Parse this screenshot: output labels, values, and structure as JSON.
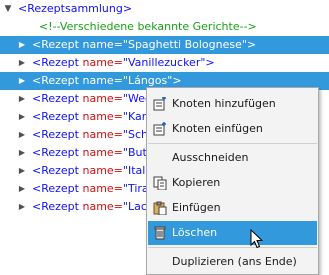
{
  "tree": {
    "root": "<Rezeptsammlung>",
    "comment": "<!--Verschiedene bekannte Gerichte-->",
    "rows": [
      {
        "open": "<Rezept",
        "attr": "name=",
        "value": "\"Spaghetti Bolognese\"",
        "close": ">",
        "selected": true
      },
      {
        "open": "<Rezept",
        "attr": "name=",
        "value": "\"Vanillezucker\"",
        "close": ">",
        "selected": false
      },
      {
        "open": "<Rezept",
        "attr": "name=",
        "value": "\"Lángos\"",
        "close": ">",
        "selected": true
      },
      {
        "open": "<Rezept",
        "attr": "name=",
        "value": "\"Wec",
        "close": "",
        "selected": false
      },
      {
        "open": "<Rezept",
        "attr": "name=",
        "value": "\"Kart",
        "close": "",
        "selected": false
      },
      {
        "open": "<Rezept",
        "attr": "name=",
        "value": "\"Scha",
        "close": "",
        "selected": false
      },
      {
        "open": "<Rezept",
        "attr": "name=",
        "value": "\"Butt",
        "close": "",
        "selected": false
      },
      {
        "open": "<Rezept",
        "attr": "name=",
        "value": "\"Itali",
        "close": "",
        "selected": false
      },
      {
        "open": "<Rezept",
        "attr": "name=",
        "value": "\"Tira",
        "close": "",
        "selected": false
      },
      {
        "open": "<Rezept",
        "attr": "name=",
        "value": "\"Lach",
        "close": "",
        "selected": false
      }
    ]
  },
  "menu": {
    "insert_node": "Knoten hinzufügen",
    "insert_node_in": "Knoten einfügen",
    "cut": "Ausschneiden",
    "copy": "Kopieren",
    "paste": "Einfügen",
    "delete": "Löschen",
    "duplicate": "Duplizieren (ans Ende)"
  },
  "colors": {
    "selection": "#3399dd",
    "tag": "#1010ff",
    "attr": "#d01010",
    "comment": "#18a018"
  }
}
